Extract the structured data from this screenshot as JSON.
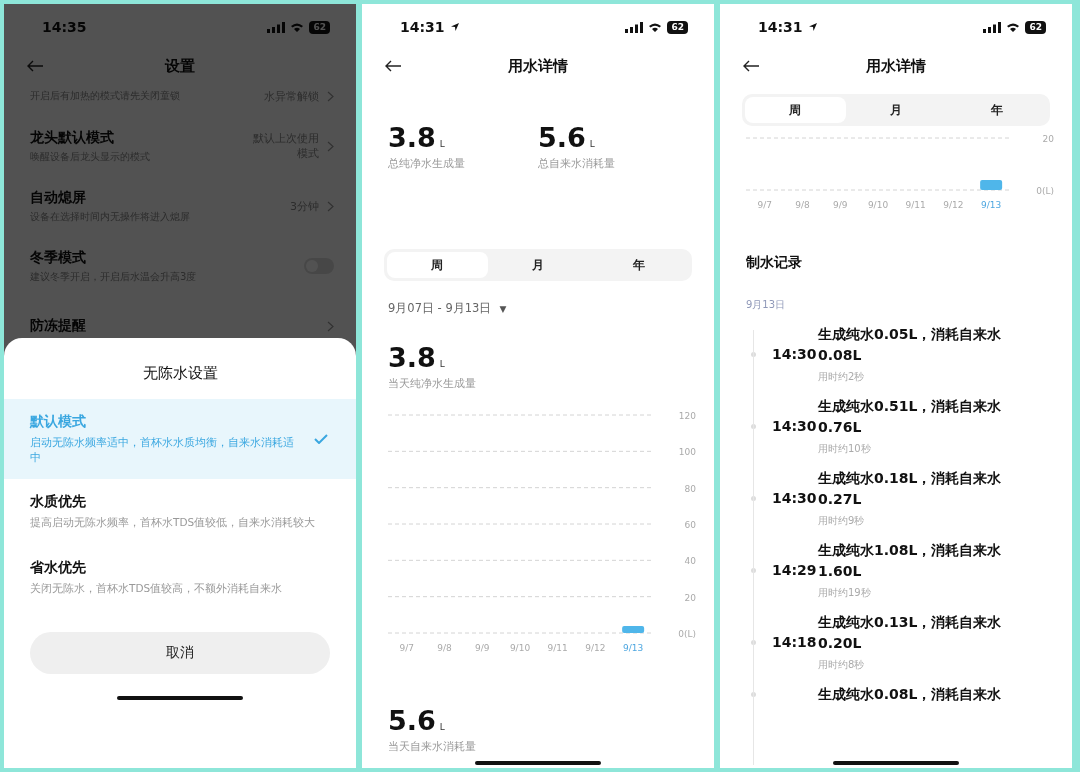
{
  "panels": [
    {
      "kind": "settings",
      "status_bar": {
        "time": "14:35",
        "location": false,
        "battery": "62"
      },
      "header": {
        "title": "设置"
      },
      "settings_rows": [
        {
          "kind": "link",
          "subtitle": "开启后有加热的模式请先关闭童锁",
          "value": "水异常解锁"
        },
        {
          "kind": "link",
          "title": "龙头默认模式",
          "subtitle": "唤醒设备后龙头显示的模式",
          "value": "默认上次使用模式"
        },
        {
          "kind": "link",
          "title": "自动熄屏",
          "subtitle": "设备在选择时间内无操作将进入熄屏",
          "value": "3分钟"
        },
        {
          "kind": "toggle",
          "title": "冬季模式",
          "subtitle": "建议冬季开启，开启后水温会升高3度",
          "on": false
        },
        {
          "kind": "link",
          "title": "防冻提醒"
        }
      ],
      "sheet": {
        "title": "无陈水设置",
        "options": [
          {
            "title": "默认模式",
            "description": "启动无陈水频率适中，首杯水水质均衡，自来水消耗适中",
            "selected": true
          },
          {
            "title": "水质优先",
            "description": "提高启动无陈水频率，首杯水TDS值较低，自来水消耗较大",
            "selected": false
          },
          {
            "title": "省水优先",
            "description": "关闭无陈水，首杯水TDS值较高，不额外消耗自来水",
            "selected": false
          }
        ],
        "cancel_button": "取消"
      }
    },
    {
      "kind": "usage_overview",
      "status_bar": {
        "time": "14:31",
        "location": true,
        "battery": "62"
      },
      "header": {
        "title": "用水详情"
      },
      "totals": [
        {
          "value": "3.8",
          "unit": "L",
          "label": "总纯净水生成量"
        },
        {
          "value": "5.6",
          "unit": "L",
          "label": "总自来水消耗量"
        }
      ],
      "tabs": [
        {
          "label": "周",
          "selected": true
        },
        {
          "label": "月",
          "selected": false
        },
        {
          "label": "年",
          "selected": false
        }
      ],
      "date_range": "9月07日 - 9月13日",
      "dropdown_arrow": "▼",
      "daily_pure": {
        "value": "3.8",
        "unit": "L",
        "label": "当天纯净水生成量"
      },
      "chart_data": {
        "type": "bar",
        "categories": [
          "9/7",
          "9/8",
          "9/9",
          "9/10",
          "9/11",
          "9/12",
          "9/13"
        ],
        "values": [
          0,
          0,
          0,
          0,
          0,
          0,
          3.8
        ],
        "grid": true,
        "ylim": [
          0,
          120
        ],
        "yticks": [
          {
            "value": 0,
            "label": "0(L)"
          },
          20,
          40,
          60,
          80,
          100,
          120
        ]
      },
      "daily_tap": {
        "value": "5.6",
        "unit": "L",
        "label": "当天自来水消耗量"
      }
    },
    {
      "kind": "usage_records",
      "status_bar": {
        "time": "14:31",
        "location": true,
        "battery": "62"
      },
      "header": {
        "title": "用水详情"
      },
      "tabs": [
        {
          "label": "周",
          "selected": true
        },
        {
          "label": "月",
          "selected": false
        },
        {
          "label": "年",
          "selected": false
        }
      ],
      "chart_data": {
        "type": "bar",
        "categories": [
          "9/7",
          "9/8",
          "9/9",
          "9/10",
          "9/11",
          "9/12",
          "9/13"
        ],
        "values": [
          0,
          0,
          0,
          0,
          0,
          0,
          3.8
        ],
        "ylim": [
          0,
          20
        ],
        "yticks": [
          {
            "value": 0,
            "label": "0(L)"
          },
          20
        ]
      },
      "section_title": "制水记录",
      "date": "9月13日",
      "records": [
        {
          "time": "14:30",
          "text": "生成纯水0.05L，消耗自来水0.08L",
          "duration": "用时约2秒"
        },
        {
          "time": "14:30",
          "text": "生成纯水0.51L，消耗自来水0.76L",
          "duration": "用时约10秒"
        },
        {
          "time": "14:30",
          "text": "生成纯水0.18L，消耗自来水0.27L",
          "duration": "用时约9秒"
        },
        {
          "time": "14:29",
          "text": "生成纯水1.08L，消耗自来水1.60L",
          "duration": "用时约19秒"
        },
        {
          "time": "14:18",
          "text": "生成纯水0.13L，消耗自来水0.20L",
          "duration": "用时约8秒"
        },
        {
          "text": "生成纯水0.08L，消耗自来水"
        }
      ]
    }
  ]
}
